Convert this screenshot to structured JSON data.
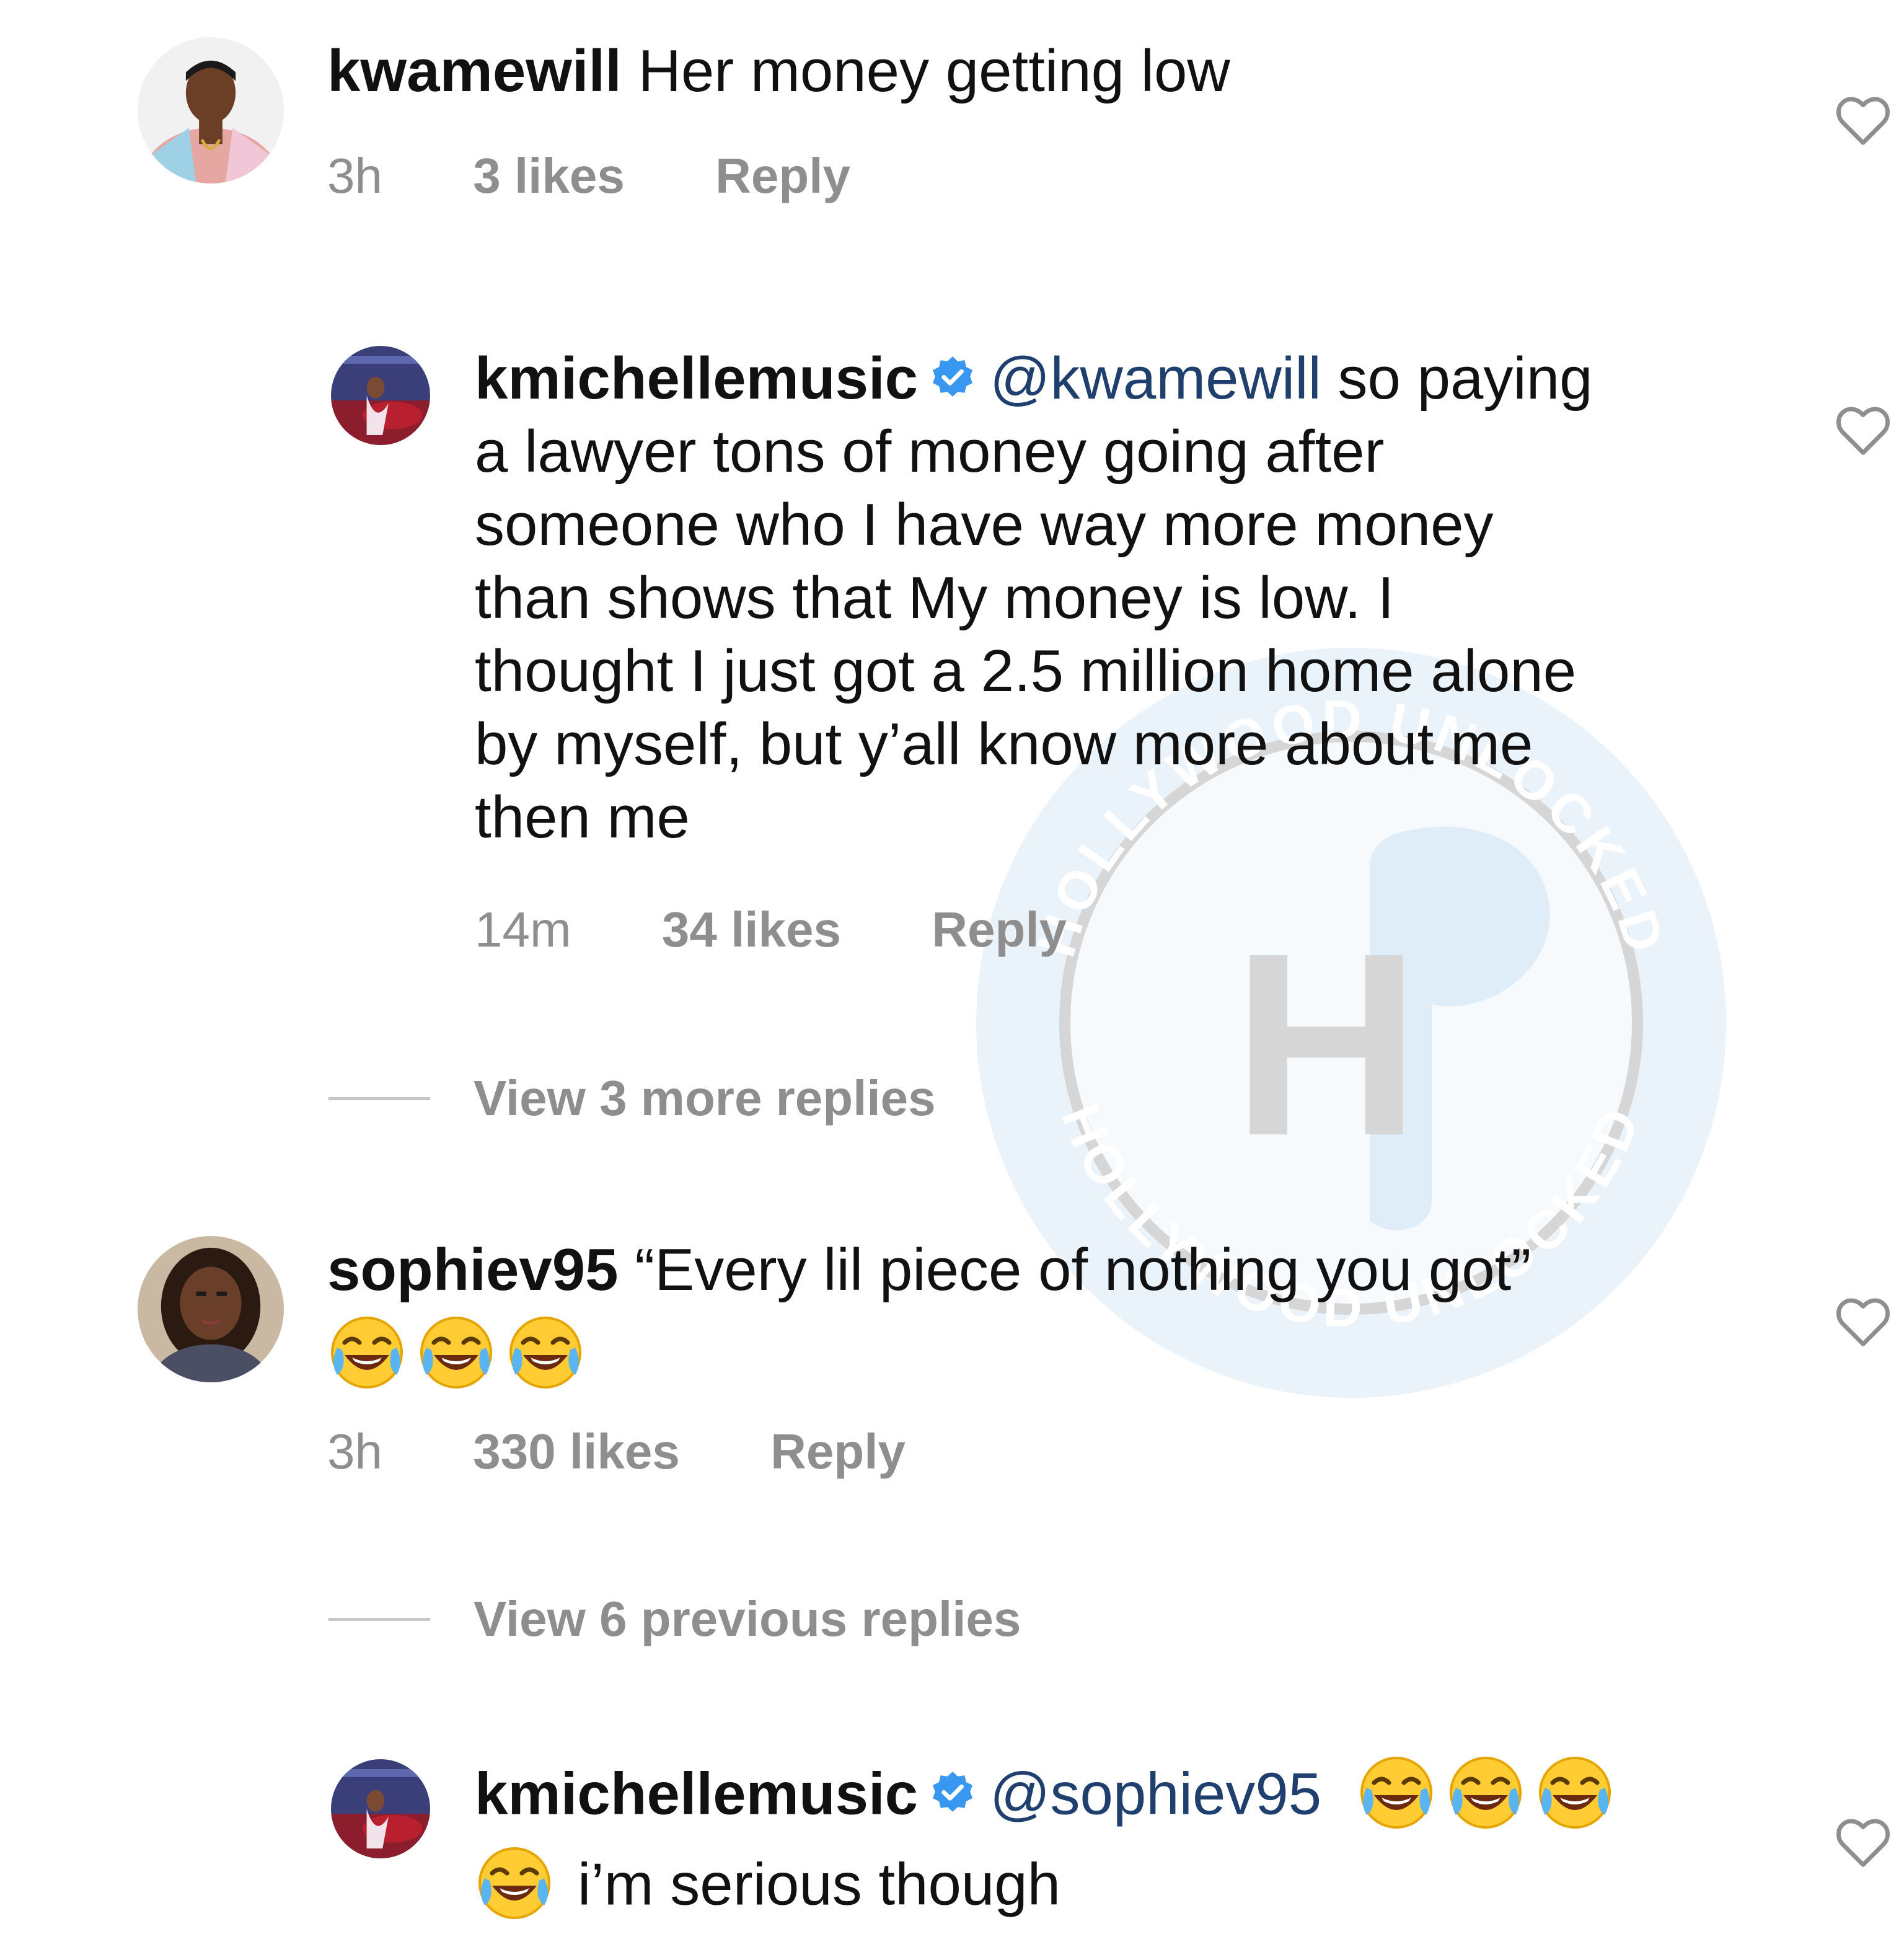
{
  "colors": {
    "text": "#111111",
    "meta": "#8e8e8e",
    "mention": "#1f3f6e",
    "verified": "#3897f0",
    "watermark_blue": "#dcebf7",
    "watermark_gray": "#d6d6d6"
  },
  "icons": {
    "like": "heart-outline-icon",
    "verified": "verified-badge-icon",
    "emoji": "face-with-tears-of-joy-emoji"
  },
  "comments": [
    {
      "username": "kwamewill",
      "text": "Her money getting low",
      "time": "3h",
      "likes": "3 likes",
      "reply": "Reply"
    },
    {
      "username": "kmichellemusic",
      "verified": true,
      "mention": "@kwamewill",
      "text_lines": [
        " so paying",
        "a lawyer tons of money going after",
        "someone who I have way more money",
        "than shows that My money is low. I",
        "thought I just got a 2.5 million home alone",
        "by myself, but y’all know more about me",
        "then me"
      ],
      "time": "14m",
      "likes": "34 likes",
      "reply": "Reply",
      "view_replies": "View 3 more replies"
    },
    {
      "username": "sophiev95",
      "text": "“Every lil piece of nothing you got”",
      "emoji_count": 3,
      "time": "3h",
      "likes": "330 likes",
      "reply": "Reply",
      "view_replies": "View 6 previous replies"
    },
    {
      "username": "kmichellemusic",
      "verified": true,
      "mention": "@sophiev95",
      "emoji_count": 4,
      "text": "i’m serious though"
    }
  ],
  "watermark": {
    "top_text": "HOLLYWOOD UNLOCKED",
    "bottom_text": "HOLLYWOOD UNLOCKED",
    "letter": "H"
  }
}
